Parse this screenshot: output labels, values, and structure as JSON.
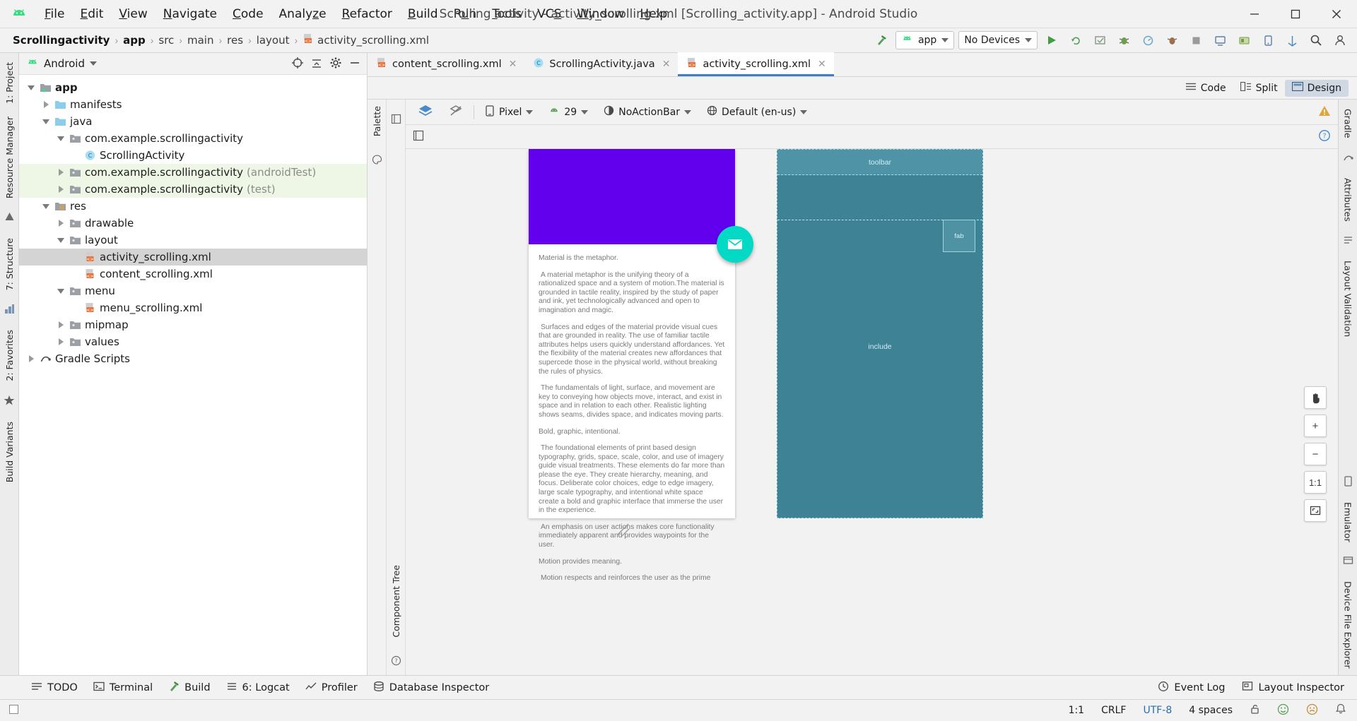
{
  "window": {
    "title": "Scrolling activity - activity_scrolling.xml [Scrolling_activity.app] - Android Studio",
    "minimize": "─",
    "maximize": "☐",
    "close": "✕"
  },
  "menubar": {
    "logo_name": "android-logo",
    "items": [
      {
        "label": "File",
        "mnemonic": "F"
      },
      {
        "label": "Edit",
        "mnemonic": "E"
      },
      {
        "label": "View",
        "mnemonic": "V"
      },
      {
        "label": "Navigate",
        "mnemonic": "N"
      },
      {
        "label": "Code",
        "mnemonic": "C"
      },
      {
        "label": "Analyze",
        "mnemonic": "z"
      },
      {
        "label": "Refactor",
        "mnemonic": "R"
      },
      {
        "label": "Build",
        "mnemonic": "B"
      },
      {
        "label": "Run",
        "mnemonic": "u"
      },
      {
        "label": "Tools",
        "mnemonic": "T"
      },
      {
        "label": "VCS",
        "mnemonic": "S"
      },
      {
        "label": "Window",
        "mnemonic": "W"
      },
      {
        "label": "Help",
        "mnemonic": "H"
      }
    ]
  },
  "navbar": {
    "breadcrumbs": [
      "Scrollingactivity",
      "app",
      "src",
      "main",
      "res",
      "layout",
      "activity_scrolling.xml"
    ],
    "separator": "›",
    "build_icon": "hammer-icon",
    "run_config": "app",
    "device": "No Devices",
    "actions": [
      "run-icon",
      "rerun-icon",
      "apply-changes-icon",
      "debug-icon",
      "profile-icon",
      "attach-debugger-icon",
      "sdk-manager-icon",
      "stop-icon",
      "avd-manager-icon",
      "layout-inspector-icon",
      "device-manager-icon",
      "sync-gradle-icon",
      "search-icon",
      "avatar-icon"
    ]
  },
  "left_rail": {
    "items": [
      "1: Project",
      "Resource Manager",
      "7: Structure",
      "2: Favorites",
      "Build Variants"
    ]
  },
  "project_panel": {
    "dropdown_label": "Android",
    "dropdown_icon": "android-logo",
    "header_actions": [
      "locate-icon",
      "collapse-all-icon",
      "settings-icon",
      "hide-icon"
    ],
    "tree": [
      {
        "depth": 0,
        "arrow": "open",
        "icon": "module-folder-icon",
        "label": "app",
        "bold": true,
        "muted": "",
        "selected": false,
        "test": false
      },
      {
        "depth": 1,
        "arrow": "closed",
        "icon": "blue-folder-icon",
        "label": "manifests",
        "bold": false,
        "muted": "",
        "selected": false,
        "test": false
      },
      {
        "depth": 1,
        "arrow": "open",
        "icon": "blue-folder-icon",
        "label": "java",
        "bold": false,
        "muted": "",
        "selected": false,
        "test": false
      },
      {
        "depth": 2,
        "arrow": "open",
        "icon": "package-icon",
        "label": "com.example.scrollingactivity",
        "bold": false,
        "muted": "",
        "selected": false,
        "test": false
      },
      {
        "depth": 3,
        "arrow": "none",
        "icon": "java-class-icon",
        "label": "ScrollingActivity",
        "bold": false,
        "muted": "",
        "selected": false,
        "test": false
      },
      {
        "depth": 2,
        "arrow": "closed",
        "icon": "package-icon",
        "label": "com.example.scrollingactivity",
        "bold": false,
        "muted": "(androidTest)",
        "selected": false,
        "test": true
      },
      {
        "depth": 2,
        "arrow": "closed",
        "icon": "package-icon",
        "label": "com.example.scrollingactivity",
        "bold": false,
        "muted": "(test)",
        "selected": false,
        "test": true
      },
      {
        "depth": 1,
        "arrow": "open",
        "icon": "res-folder-icon",
        "label": "res",
        "bold": false,
        "muted": "",
        "selected": false,
        "test": false
      },
      {
        "depth": 2,
        "arrow": "closed",
        "icon": "package-icon",
        "label": "drawable",
        "bold": false,
        "muted": "",
        "selected": false,
        "test": false
      },
      {
        "depth": 2,
        "arrow": "open",
        "icon": "package-icon",
        "label": "layout",
        "bold": false,
        "muted": "",
        "selected": false,
        "test": false
      },
      {
        "depth": 3,
        "arrow": "none",
        "icon": "xml-layout-icon",
        "label": "activity_scrolling.xml",
        "bold": false,
        "muted": "",
        "selected": true,
        "test": false
      },
      {
        "depth": 3,
        "arrow": "none",
        "icon": "xml-layout-icon",
        "label": "content_scrolling.xml",
        "bold": false,
        "muted": "",
        "selected": false,
        "test": false
      },
      {
        "depth": 2,
        "arrow": "open",
        "icon": "package-icon",
        "label": "menu",
        "bold": false,
        "muted": "",
        "selected": false,
        "test": false
      },
      {
        "depth": 3,
        "arrow": "none",
        "icon": "xml-layout-icon",
        "label": "menu_scrolling.xml",
        "bold": false,
        "muted": "",
        "selected": false,
        "test": false
      },
      {
        "depth": 2,
        "arrow": "closed",
        "icon": "package-icon",
        "label": "mipmap",
        "bold": false,
        "muted": "",
        "selected": false,
        "test": false
      },
      {
        "depth": 2,
        "arrow": "closed",
        "icon": "package-icon",
        "label": "values",
        "bold": false,
        "muted": "",
        "selected": false,
        "test": false
      },
      {
        "depth": 0,
        "arrow": "closed",
        "icon": "gradle-icon",
        "label": "Gradle Scripts",
        "bold": false,
        "muted": "",
        "selected": false,
        "test": false
      }
    ]
  },
  "editor": {
    "tabs": [
      {
        "label": "content_scrolling.xml",
        "icon": "xml-layout-icon",
        "active": false,
        "close": "✕"
      },
      {
        "label": "ScrollingActivity.java",
        "icon": "java-class-icon",
        "active": false,
        "close": "✕"
      },
      {
        "label": "activity_scrolling.xml",
        "icon": "xml-layout-icon",
        "active": true,
        "close": "✕"
      }
    ],
    "modes": [
      {
        "label": "Code",
        "icon": "code-mode-icon",
        "active": false
      },
      {
        "label": "Split",
        "icon": "split-mode-icon",
        "active": false
      },
      {
        "label": "Design",
        "icon": "design-mode-icon",
        "active": true
      }
    ]
  },
  "design_toolbar": {
    "design_surface_icon": "layers-icon",
    "blueprint_toggle_icon": "blueprint-toggle-icon",
    "device": "Pixel",
    "device_icon": "phone-icon",
    "api_level": "29",
    "api_icon": "android-logo",
    "theme": "NoActionBar",
    "theme_icon": "theme-icon",
    "locale": "Default (en-us)",
    "locale_icon": "globe-icon",
    "warning_icon": "warning-icon",
    "subbar_icon": "design-options-icon",
    "help_icon": "help-icon"
  },
  "palette_rail": {
    "label": "Palette",
    "icon": "palette-icon"
  },
  "component_tree_rail": {
    "label": "Component Tree",
    "icon": "component-tree-icon"
  },
  "right_rails": {
    "items": [
      "Gradle",
      "Attributes",
      "Layout Validation",
      "Emulator",
      "Device File Explorer"
    ]
  },
  "preview": {
    "hero_color": "#6200EE",
    "fab_color": "#03DAC5",
    "fab_icon": "email-icon",
    "paragraphs": [
      "Material is the metaphor.",
      " A material metaphor is the unifying theory of a rationalized space and a system of motion.The material is grounded in tactile reality, inspired by the study of paper and ink, yet technologically advanced and open to imagination and magic.",
      " Surfaces and edges of the material provide visual cues that are grounded in reality. The use of familiar tactile attributes helps users quickly understand affordances. Yet the flexibility of the material creates new affordances that supercede those in the physical world, without breaking the rules of physics.",
      " The fundamentals of light, surface, and movement are key to conveying how objects move, interact, and exist in space and in relation to each other. Realistic lighting shows seams, divides space, and indicates moving parts.",
      "Bold, graphic, intentional.",
      " The foundational elements of print based design typography, grids, space, scale, color, and use of imagery guide visual treatments. These elements do far more than please the eye. They create hierarchy, meaning, and focus. Deliberate color choices, edge to edge imagery, large scale typography, and intentional white space create a bold and graphic interface that immerse the user in the experience.",
      " An emphasis on user actions makes core functionality immediately apparent and provides waypoints for the user.",
      "Motion provides meaning.",
      " Motion respects and reinforces the user as the prime"
    ]
  },
  "blueprint": {
    "toolbar_label": "toolbar",
    "include_label": "include",
    "fab_label": "fab",
    "surface_color": "#4a8d9e"
  },
  "zoom_controls": {
    "pan": "pan-hand-icon",
    "zoom_in": "+",
    "zoom_out": "−",
    "zoom_actual": "1:1",
    "zoom_fit": "zoom-to-fit-icon"
  },
  "bottombar": {
    "items": [
      {
        "label": "TODO",
        "icon": "todo-icon"
      },
      {
        "label": "Terminal",
        "icon": "terminal-icon"
      },
      {
        "label": "Build",
        "icon": "build-icon"
      },
      {
        "label": "6: Logcat",
        "icon": "logcat-icon"
      },
      {
        "label": "Profiler",
        "icon": "profiler-icon"
      },
      {
        "label": "Database Inspector",
        "icon": "database-icon"
      }
    ],
    "right_items": [
      {
        "label": "Event Log",
        "icon": "event-log-icon"
      },
      {
        "label": "Layout Inspector",
        "icon": "layout-inspector-icon"
      }
    ]
  },
  "statusbar": {
    "left_icon": "toggle-toolwindows-icon",
    "caret_position": "1:1",
    "line_separator": "CRLF",
    "encoding": "UTF-8",
    "indent": "4 spaces",
    "lock_icon": "unlocked-icon",
    "face_ok_icon": "inspection-ok-icon",
    "face_warn_icon": "inspection-warn-icon",
    "notification_icon": "notifications-icon",
    "memory_icon": "memory-icon"
  }
}
